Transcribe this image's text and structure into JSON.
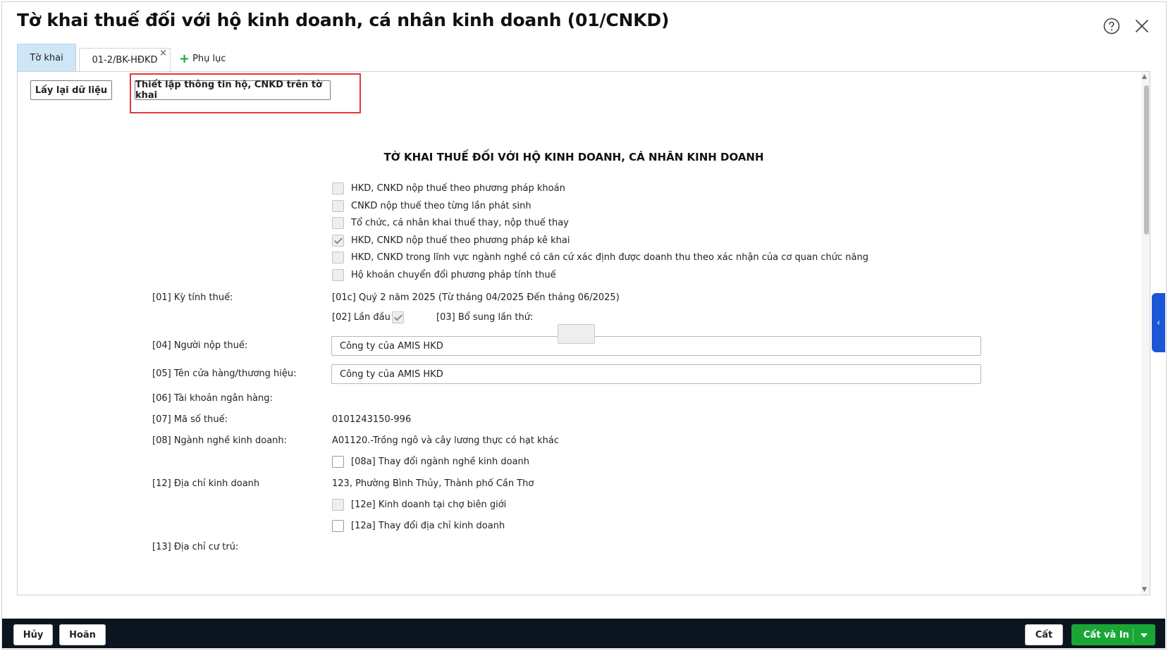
{
  "window": {
    "title": "Tờ khai thuế đối với hộ kinh doanh, cá nhân kinh doanh (01/CNKD)",
    "help_icon": "question-circle-icon",
    "close_icon": "close-icon"
  },
  "tabs": [
    {
      "label": "Tờ khai",
      "active": true
    },
    {
      "label": "01-2/BK-HĐKD",
      "active": false,
      "closable": true
    }
  ],
  "tab_close_glyph": "×",
  "add_appendix": {
    "icon": "plus-icon",
    "label": "Phụ lục"
  },
  "toolbar": {
    "reload_label": "Lấy lại dữ liệu",
    "setup_label": "Thiết lập thông tin hộ, CNKD trên tờ khai"
  },
  "form": {
    "heading": "TỜ KHAI THUẾ ĐỐI VỚI HỘ KINH DOANH, CÁ NHÂN KINH DOANH",
    "methods": [
      {
        "label": "HKD, CNKD nộp thuế theo phương pháp khoán",
        "checked": false
      },
      {
        "label": "CNKD nộp thuế theo từng lần phát sinh",
        "checked": false
      },
      {
        "label": "Tổ chức, cá nhân khai thuế thay, nộp thuế thay",
        "checked": false
      },
      {
        "label": "HKD, CNKD nộp thuế theo phương pháp kê khai",
        "checked": true
      },
      {
        "label": "HKD, CNKD trong lĩnh vực ngành nghề có căn cứ xác định được doanh thu theo xác nhận của cơ quan chức năng",
        "checked": false
      },
      {
        "label": "Hộ khoán chuyển đổi phương pháp tính thuế",
        "checked": false
      }
    ],
    "period_label": "[01] Kỳ tính thuế:",
    "period_value": "[01c] Quý 2 năm 2025 (Từ tháng 04/2025 Đến tháng 06/2025)",
    "first_time_label": "[02] Lần đầu",
    "supplement_label": "[03] Bổ sung lần thứ:",
    "supplement_value": "",
    "taxpayer_label": "[04] Người nộp thuế:",
    "taxpayer_value": "Công ty của AMIS HKD",
    "store_label": "[05] Tên cửa hàng/thương hiệu:",
    "store_value": "Công ty của AMIS HKD",
    "bank_label": "[06] Tài khoản ngân hàng:",
    "tax_code_label": "[07] Mã số thuế:",
    "tax_code_value": "0101243150-996",
    "business_label": "[08] Ngành nghề kinh doanh:",
    "business_value": "A01120.-Trồng ngô và cây lương thực có hạt khác",
    "change_business_label": "[08a] Thay đổi ngành nghề kinh doanh",
    "address_label": "[12] Địa chỉ kinh doanh",
    "address_value": "123, Phường Bình Thủy, Thành phố Cần Thơ",
    "border_market_label": "[12e] Kinh doanh tại chợ biên giới",
    "change_address_label": "[12a] Thay đổi địa chỉ kinh doanh",
    "residence_label": "[13] Địa chỉ cư trú:"
  },
  "footer": {
    "cancel_label": "Hủy",
    "defer_label": "Hoãn",
    "save_label": "Cất",
    "save_print_label": "Cất và In"
  },
  "colors": {
    "accent_green": "#19a636",
    "highlight_red": "#e0393b",
    "tab_active_bg": "#cfe6f7",
    "footer_bg": "#0c1420",
    "side_tab_blue": "#1a56d6"
  }
}
